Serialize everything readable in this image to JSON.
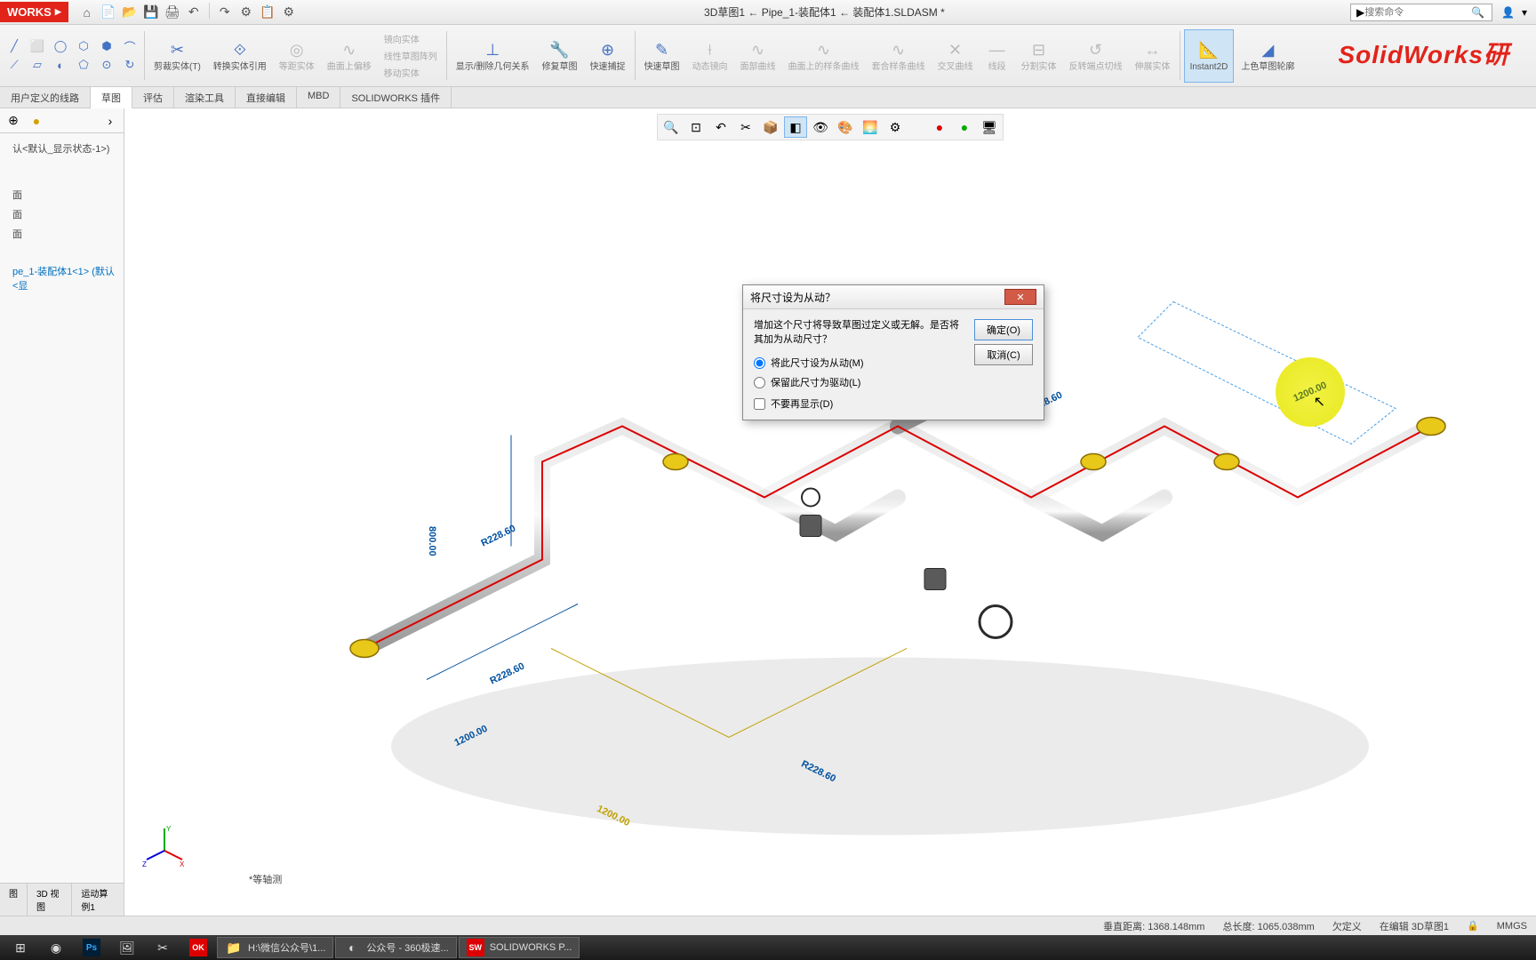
{
  "title": "3D草图1 ← Pipe_1-装配体1 ← 装配体1.SLDASM *",
  "logo": "WORKS",
  "search_placeholder": "搜索命令",
  "watermark": "SolidWorks研",
  "qat": [
    "⌂",
    "📄",
    "📂",
    "💾",
    "🖨",
    "↶",
    "↷",
    "⚙",
    "📋",
    "⚙"
  ],
  "ribbon": {
    "sketch_tools": [
      [
        "╱",
        "⬜",
        "◯",
        "⬡",
        "⬢",
        "⌒"
      ],
      [
        "⟋",
        "▱",
        "◐",
        "⬠",
        "⊙",
        "↻"
      ]
    ],
    "mirror": "镜向实体",
    "trim": {
      "label": "剪裁实体(T)",
      "icon": "✂"
    },
    "convert": {
      "label": "转换实体引用",
      "icon": "⟐"
    },
    "equidist": {
      "label": "等距实体",
      "icon": "◎"
    },
    "oncurve": {
      "label": "曲面上偏移",
      "icon": "∿"
    },
    "linear_pattern": "线性草图阵列",
    "move": "移动实体",
    "show_hide": {
      "label": "显示/删除几何关系",
      "icon": "⊥"
    },
    "repair": {
      "label": "修复草图",
      "icon": "🔧"
    },
    "quick_snap": {
      "label": "快速捕捉",
      "icon": "⊕"
    },
    "rapid": {
      "label": "快速草图",
      "icon": "✎"
    },
    "dynamic_mirror": {
      "label": "动态镜向",
      "icon": "⟊"
    },
    "surf_curve": {
      "label": "面部曲线",
      "icon": "∿"
    },
    "spline_surf": {
      "label": "曲面上的样条曲线",
      "icon": "∿"
    },
    "fit_spline": {
      "label": "套合样条曲线",
      "icon": "∿"
    },
    "intersect": {
      "label": "交叉曲线",
      "icon": "✕"
    },
    "segment": {
      "label": "线段",
      "icon": "—"
    },
    "split": {
      "label": "分割实体",
      "icon": "⊟"
    },
    "reverse": {
      "label": "反转端点切线",
      "icon": "↺"
    },
    "stretch": {
      "label": "伸展实体",
      "icon": "↔"
    },
    "instant2d": {
      "label": "Instant2D",
      "icon": "📐"
    },
    "shade_sketch": {
      "label": "上色草图轮廓",
      "icon": "◢"
    }
  },
  "tabs": [
    "用户定义的线路",
    "草图",
    "评估",
    "渲染工具",
    "直接编辑",
    "MBD",
    "SOLIDWORKS 插件"
  ],
  "active_tab": "草图",
  "sidebar": {
    "state": "认<默认_显示状态-1>)",
    "items": [
      "面",
      "面",
      "面"
    ],
    "special": "pe_1-装配体1<1> (默认<显"
  },
  "dialog": {
    "title": "将尺寸设为从动？",
    "message": "增加这个尺寸将导致草图过定义或无解。是否将其加为从动尺寸？",
    "radio1": "将此尺寸设为从动(M)",
    "radio2": "保留此尺寸为驱动(L)",
    "checkbox": "不要再显示(D)",
    "ok": "确定(O)",
    "cancel": "取消(C)"
  },
  "dimensions": {
    "d1": "R228.60",
    "d2": "800.00",
    "d3": "1200.00",
    "d4": "R228.60",
    "d5": "1200.00",
    "d6": "R228.60",
    "d7": "R228.60",
    "highlight": "1200.00"
  },
  "iso_label": "*等轴测",
  "bottom_tabs": [
    "图",
    "3D 视图",
    "运动算例1"
  ],
  "status": {
    "dist": "垂直距离: 1368.148mm",
    "len": "总长度: 1065.038mm",
    "underdef": "欠定义",
    "editing": "在编辑 3D草图1",
    "units": "MMGS"
  },
  "taskbar": [
    {
      "icon": "⊞",
      "label": ""
    },
    {
      "icon": "◉",
      "label": ""
    },
    {
      "icon": "Ps",
      "label": ""
    },
    {
      "icon": "🖼",
      "label": ""
    },
    {
      "icon": "✂",
      "label": ""
    },
    {
      "icon": "OK",
      "label": ""
    },
    {
      "icon": "📁",
      "label": "H:\\微信公众号\\1..."
    },
    {
      "icon": "◐",
      "label": "公众号 - 360极速..."
    },
    {
      "icon": "SW",
      "label": "SOLIDWORKS P..."
    }
  ]
}
